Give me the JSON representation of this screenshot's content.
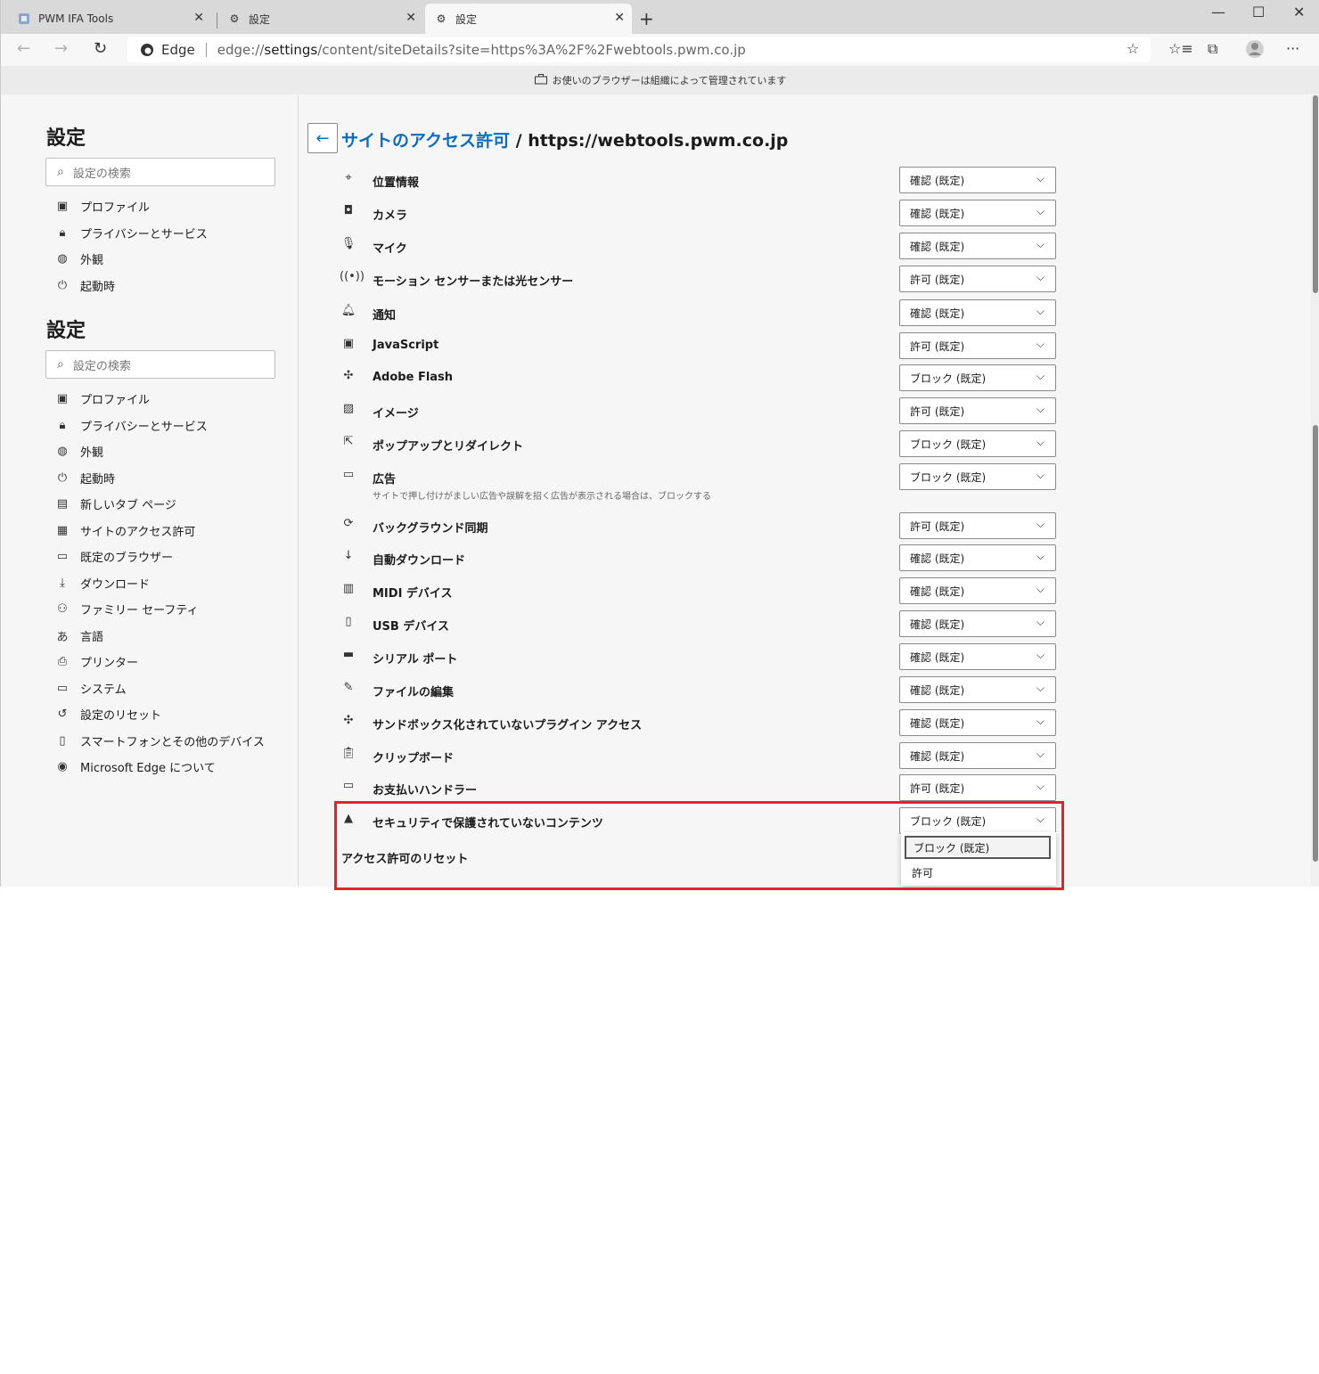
{
  "browser": {
    "tabs": [
      {
        "title": "PWM IFA Tools"
      },
      {
        "title": "設定"
      },
      {
        "title": "設定"
      }
    ],
    "address": {
      "edge_label": "Edge",
      "url_prefix": "edge://",
      "url_host": "settings",
      "url_rest": "/content/siteDetails?site=https%3A%2F%2Fwebtools.pwm.co.jp"
    },
    "banner": "お使いのブラウザーは組織によって管理されています"
  },
  "sidebar": {
    "title1": "設定",
    "search_placeholder": "設定の検索",
    "items_top": [
      {
        "label": "プロファイル",
        "icon": "profile-icon"
      },
      {
        "label": "プライバシーとサービス",
        "icon": "lock-icon"
      },
      {
        "label": "外観",
        "icon": "palette-icon"
      },
      {
        "label": "起動時",
        "icon": "power-icon"
      }
    ],
    "title2": "設定",
    "search_placeholder2": "設定の検索",
    "items": [
      {
        "label": "プロファイル",
        "icon": "profile-icon"
      },
      {
        "label": "プライバシーとサービス",
        "icon": "lock-icon"
      },
      {
        "label": "外観",
        "icon": "palette-icon"
      },
      {
        "label": "起動時",
        "icon": "power-icon"
      },
      {
        "label": "新しいタブ ページ",
        "icon": "grid-icon"
      },
      {
        "label": "サイトのアクセス許可",
        "icon": "site-permissions-icon"
      },
      {
        "label": "既定のブラウザー",
        "icon": "browser-icon"
      },
      {
        "label": "ダウンロード",
        "icon": "download-icon"
      },
      {
        "label": "ファミリー セーフティ",
        "icon": "family-icon"
      },
      {
        "label": "言語",
        "icon": "language-icon"
      },
      {
        "label": "プリンター",
        "icon": "printer-icon"
      },
      {
        "label": "システム",
        "icon": "system-icon"
      },
      {
        "label": "設定のリセット",
        "icon": "reset-icon"
      },
      {
        "label": "スマートフォンとその他のデバイス",
        "icon": "phone-icon"
      },
      {
        "label": "Microsoft Edge について",
        "icon": "edge-logo-icon"
      }
    ]
  },
  "main": {
    "breadcrumb_link": "サイトのアクセス許可",
    "breadcrumb_sep": " / ",
    "site": "https://webtools.pwm.co.jp",
    "permissions": [
      {
        "label": "位置情報",
        "value": "確認 (既定)",
        "icon": "location-icon"
      },
      {
        "label": "カメラ",
        "value": "確認 (既定)",
        "icon": "camera-icon"
      },
      {
        "label": "マイク",
        "value": "確認 (既定)",
        "icon": "mic-icon"
      },
      {
        "label": "モーション センサーまたは光センサー",
        "value": "許可 (既定)",
        "icon": "sensor-icon"
      },
      {
        "label": "通知",
        "value": "確認 (既定)",
        "icon": "bell-icon"
      },
      {
        "label": "JavaScript",
        "value": "許可 (既定)",
        "icon": "js-icon"
      },
      {
        "label": "Adobe Flash",
        "value": "ブロック (既定)",
        "icon": "puzzle-icon"
      },
      {
        "label": "イメージ",
        "value": "許可 (既定)",
        "icon": "image-icon"
      },
      {
        "label": "ポップアップとリダイレクト",
        "value": "ブロック (既定)",
        "icon": "popup-icon"
      },
      {
        "label": "広告",
        "sub": "サイトで押し付けがましい広告や誤解を招く広告が表示される場合は、ブロックする",
        "value": "ブロック (既定)",
        "icon": "ad-icon"
      },
      {
        "label": "バックグラウンド同期",
        "value": "許可 (既定)",
        "icon": "sync-icon"
      },
      {
        "label": "自動ダウンロード",
        "value": "確認 (既定)",
        "icon": "download-icon"
      },
      {
        "label": "MIDI デバイス",
        "value": "確認 (既定)",
        "icon": "midi-icon"
      },
      {
        "label": "USB デバイス",
        "value": "確認 (既定)",
        "icon": "usb-icon"
      },
      {
        "label": "シリアル ポート",
        "value": "確認 (既定)",
        "icon": "serial-icon"
      },
      {
        "label": "ファイルの編集",
        "value": "確認 (既定)",
        "icon": "file-edit-icon"
      },
      {
        "label": "サンドボックス化されていないプラグイン アクセス",
        "value": "確認 (既定)",
        "icon": "puzzle-icon"
      },
      {
        "label": "クリップボード",
        "value": "確認 (既定)",
        "icon": "clipboard-icon"
      },
      {
        "label": "お支払いハンドラー",
        "value": "許可 (既定)",
        "icon": "card-icon"
      },
      {
        "label": "セキュリティで保護されていないコンテンツ",
        "value": "ブロック (既定)",
        "icon": "warning-icon"
      }
    ],
    "reset_label": "アクセス許可のリセット",
    "open_menu": {
      "options": [
        "ブロック (既定)",
        "許可"
      ]
    }
  },
  "colors": {
    "accent": "#0f6cbd",
    "highlight": "#e3232b"
  }
}
